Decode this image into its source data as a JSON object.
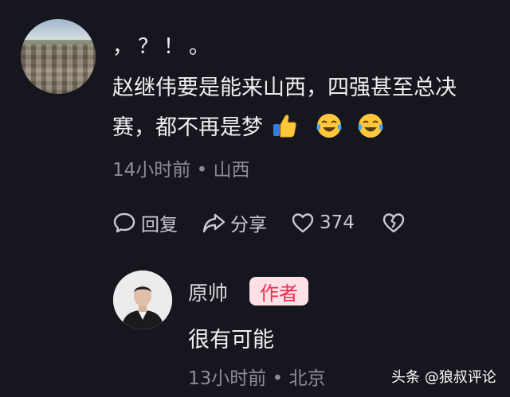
{
  "comment": {
    "line1": "，？！。",
    "line2": "赵继伟要是能来山西，四强甚至总决",
    "line3": "赛，都不再是梦",
    "emojis": [
      "thumbs-up-icon",
      "crying-laughing-icon",
      "crying-laughing-icon"
    ],
    "meta": "14小时前 • 山西",
    "actions": {
      "reply_label": "回复",
      "share_label": "分享",
      "like_count": "374"
    }
  },
  "reply": {
    "name": "原帅",
    "badge": "作者",
    "text": "很有可能",
    "meta": "13小时前 • 北京"
  },
  "watermark": "头条 @狼叔评论",
  "colors": {
    "background": "#16161f",
    "badge_bg": "#fde1e6",
    "badge_text": "#f02d4d",
    "meta_text": "#8d8d96"
  }
}
